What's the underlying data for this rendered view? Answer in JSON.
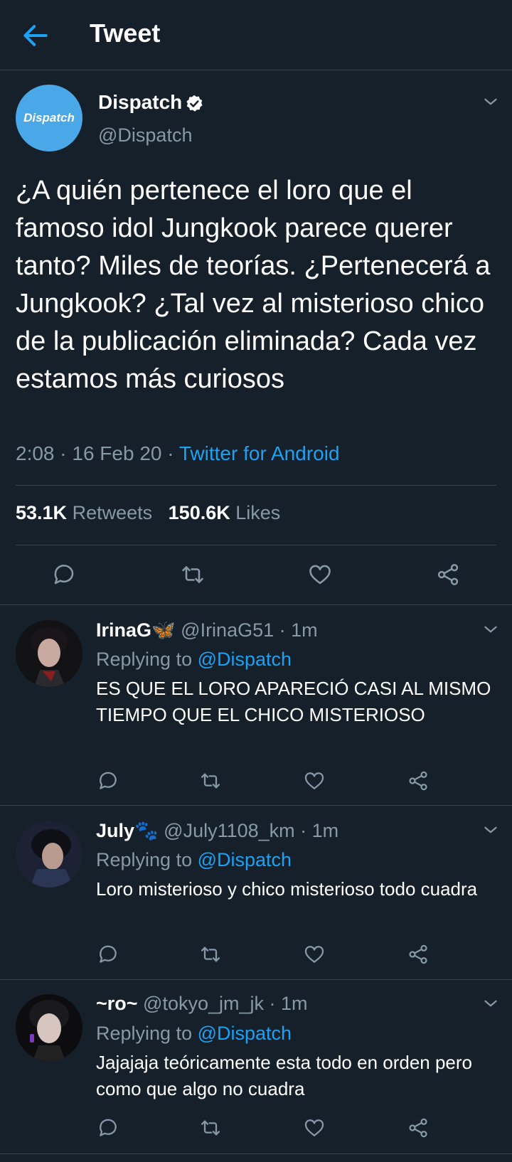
{
  "header": {
    "title": "Tweet"
  },
  "tweet": {
    "author_name": "Dispatch",
    "author_handle": "@Dispatch",
    "avatar_text": "Dispatch",
    "text": "¿A quién pertenece el loro que el famoso idol Jungkook parece querer tanto?  Miles de teorías. ¿Pertenecerá a Jungkook? ¿Tal vez al misterioso chico de la publicación eliminada? Cada vez estamos más curiosos",
    "time": "2:08 · 16 Feb 20 · ",
    "source": "Twitter for Android",
    "retweets": "53.1K",
    "retweets_label": "Retweets",
    "likes": "150.6K",
    "likes_label": "Likes"
  },
  "replies": [
    {
      "name": "IrinaG",
      "emoji": "🦋",
      "meta": " @IrinaG51 · 1m",
      "replying_prefix": "Replying to ",
      "replying_to": "@Dispatch",
      "text": "ES QUE EL LORO APARECIÓ CASI AL MISMO TIEMPO QUE EL CHICO MISTERIOSO"
    },
    {
      "name": "July",
      "emoji": "🐾",
      "meta": " @July1108_km · 1m",
      "replying_prefix": "Replying to ",
      "replying_to": "@Dispatch",
      "text": "Loro misterioso y chico misterioso todo cuadra"
    },
    {
      "name": "~ro~",
      "emoji": "",
      "meta": " @tokyo_jm_jk · 1m",
      "replying_prefix": "Replying to ",
      "replying_to": "@Dispatch",
      "text": "Jajajaja teóricamente esta todo en orden pero como que algo no cuadra"
    }
  ],
  "icons": {
    "back": "arrow-left-icon",
    "menu": "chevron-down-icon",
    "reply": "comment-icon",
    "retweet": "retweet-icon",
    "like": "heart-icon",
    "share": "share-icon",
    "verified": "verified-badge-icon"
  },
  "colors": {
    "background": "#15202b",
    "accent": "#1da1f2",
    "secondary_text": "#8899a6",
    "divider": "#38444d"
  }
}
